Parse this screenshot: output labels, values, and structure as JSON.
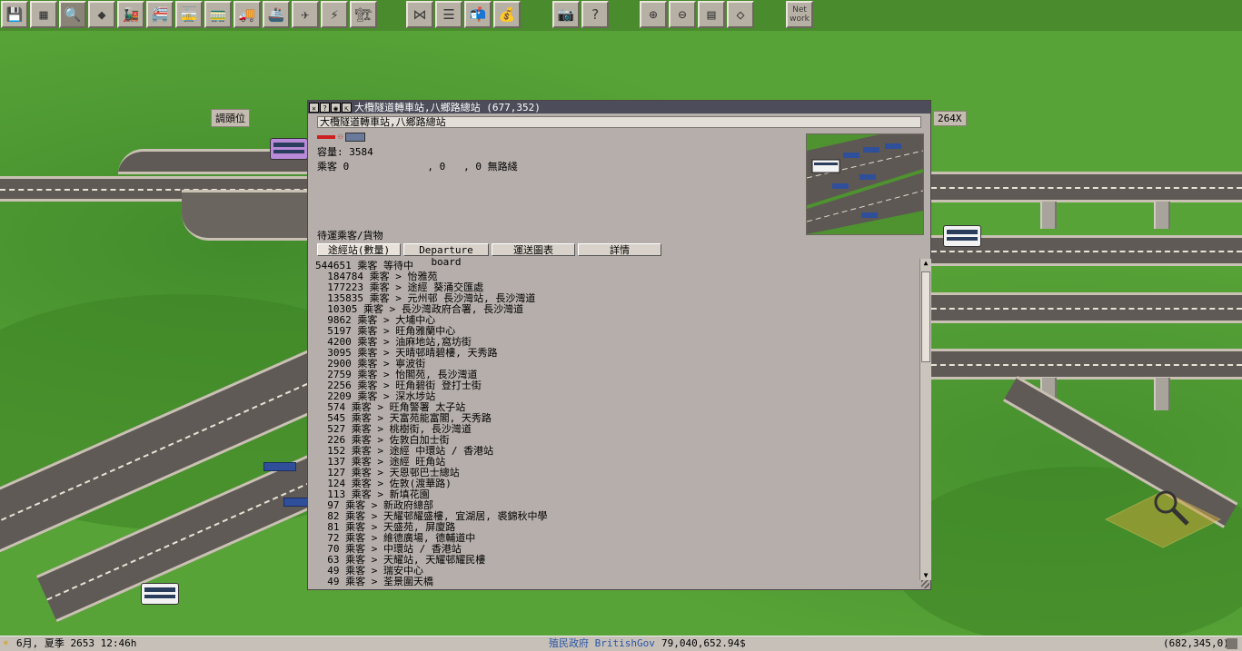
{
  "toolbar": {
    "tools": [
      {
        "name": "save-tool-icon",
        "glyph": "💾"
      },
      {
        "name": "map-tool-icon",
        "glyph": "▦"
      },
      {
        "name": "inspect-tool-icon",
        "glyph": "🔍"
      },
      {
        "name": "terraform-tool-icon",
        "glyph": "◆"
      },
      {
        "name": "rail-tool-icon",
        "glyph": "🚂"
      },
      {
        "name": "monorail-tool-icon",
        "glyph": "🚝"
      },
      {
        "name": "tram-tool-icon",
        "glyph": "🚋"
      },
      {
        "name": "tram2-tool-icon",
        "glyph": "🚃"
      },
      {
        "name": "road-tool-icon",
        "glyph": "🚚"
      },
      {
        "name": "ship-tool-icon",
        "glyph": "🚢"
      },
      {
        "name": "air-tool-icon",
        "glyph": "✈"
      },
      {
        "name": "powerline-tool-icon",
        "glyph": "⚡"
      },
      {
        "name": "special-tool-icon",
        "glyph": "🏗"
      },
      {
        "name": "lines-tool-icon",
        "glyph": "⋈"
      },
      {
        "name": "list-tool-icon",
        "glyph": "☰"
      },
      {
        "name": "mail-tool-icon",
        "glyph": "📬"
      },
      {
        "name": "finance-tool-icon",
        "glyph": "💰"
      },
      {
        "name": "screenshot-tool-icon",
        "glyph": "📷"
      },
      {
        "name": "help-tool-icon",
        "glyph": "?"
      },
      {
        "name": "zoom-in-tool-icon",
        "glyph": "⊕"
      },
      {
        "name": "zoom-out-tool-icon",
        "glyph": "⊖"
      },
      {
        "name": "track-view-tool-icon",
        "glyph": "▤"
      },
      {
        "name": "grid-tool-icon",
        "glyph": "◇"
      }
    ],
    "network_label": "Net\nwork"
  },
  "world": {
    "label_left": "調頭位",
    "label_right": "264X"
  },
  "window": {
    "title": "大欖隧道轉車站,八鄉路總站 (677,352)",
    "station_name": "大欖隧道轉車站,八鄉路總站",
    "capacity": "容量: 3584",
    "passengers": "乘客 0             , 0   , 0 無路綫",
    "waiting_heading": "待運乘客/貨物",
    "tabs": [
      "途經站(數量)",
      "Departure board",
      "運送圖表",
      "詳情"
    ],
    "rows": [
      "544651 乘客 等待中",
      "  184784 乘客 > 怡雅苑",
      "  177223 乘客 > 途經 葵涌交匯處",
      "  135835 乘客 > 元州邨 長沙灣站, 長沙灣道",
      "  10305 乘客 > 長沙灣政府合署, 長沙灣道",
      "  9862 乘客 > 大埔中心",
      "  5197 乘客 > 旺角雅蘭中心",
      "  4200 乘客 > 油麻地站,窩坊街",
      "  3095 乘客 > 天晴邨晴碧樓, 天秀路",
      "  2900 乘客 > 寧波街",
      "  2759 乘客 > 怡閣苑, 長沙灣道",
      "  2256 乘客 > 旺角碧街 登打士街",
      "  2209 乘客 > 深水埗站",
      "  574 乘客 > 旺角警署 太子站",
      "  545 乘客 > 天富苑能富閣, 天秀路",
      "  527 乘客 > 桃樹街, 長沙灣道",
      "  226 乘客 > 佐敦白加士街",
      "  152 乘客 > 途經 中環站 / 香港站",
      "  137 乘客 > 途經 旺角站",
      "  127 乘客 > 天恩邨巴士總站",
      "  124 乘客 > 佐敦(渡華路)",
      "  113 乘客 > 新填花園",
      "  97 乘客 > 新政府總部",
      "  82 乘客 > 天耀邨耀盛樓, 宜湖居, 裘錦秋中學",
      "  81 乘客 > 天盛苑, 屏廈路",
      "  72 乘客 > 維德廣場, 德輔道中",
      "  70 乘客 > 中環站 / 香港站",
      "  63 乘客 > 天耀站, 天耀邨耀民樓",
      "  49 乘客 > 瑞安中心",
      "  49 乘客 > 荃景圍天橋"
    ]
  },
  "status": {
    "date": "6月, 夏季 2653 12:46h",
    "company": "殖民政府 BritishGov",
    "money": "79,040,652.94$",
    "coords": "(682,345,0)",
    "money_color": "#000000",
    "company_color": "#2a56a8"
  }
}
